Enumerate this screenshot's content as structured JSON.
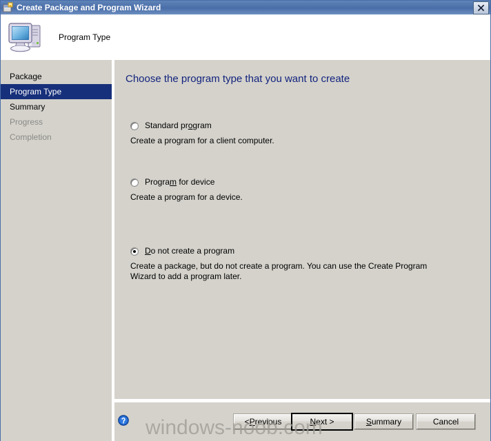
{
  "window": {
    "title": "Create Package and Program Wizard",
    "title_icon": "package-wizard-icon",
    "close_icon": "close-icon",
    "titlebar_color": "#4a6ea9"
  },
  "header": {
    "title": "Program Type",
    "icon": "computer-icon"
  },
  "sidebar": {
    "items": [
      {
        "label": "Package",
        "state": "normal"
      },
      {
        "label": "Program Type",
        "state": "selected"
      },
      {
        "label": "Summary",
        "state": "normal"
      },
      {
        "label": "Progress",
        "state": "disabled"
      },
      {
        "label": "Completion",
        "state": "disabled"
      }
    ],
    "selected_color": "#17307b"
  },
  "content": {
    "heading": "Choose the program type that you want to create",
    "heading_color": "#12237e",
    "options": [
      {
        "label_pre": "Standard pr",
        "label_accel": "o",
        "label_post": "gram",
        "description": "Create a program for a client computer.",
        "checked": false
      },
      {
        "label_pre": "Progra",
        "label_accel": "m",
        "label_post": " for device",
        "description": "Create a program for a device.",
        "checked": false
      },
      {
        "label_pre": "",
        "label_accel": "D",
        "label_post": "o not create a program",
        "description": "Create a package, but do not create a program. You can use the Create Program Wizard to add a program later.",
        "checked": true
      }
    ]
  },
  "footer": {
    "help_icon": "help-question-icon",
    "buttons": [
      {
        "pre": "< ",
        "accel": "P",
        "post": "revious",
        "name": "previous",
        "default": false
      },
      {
        "pre": "",
        "accel": "N",
        "post": "ext >",
        "name": "next",
        "default": true
      },
      {
        "pre": "",
        "accel": "S",
        "post": "ummary",
        "name": "summary",
        "default": false
      },
      {
        "pre": "",
        "accel": "",
        "post": "Cancel",
        "name": "cancel",
        "default": false
      }
    ],
    "watermark": "windows-noob.com"
  }
}
